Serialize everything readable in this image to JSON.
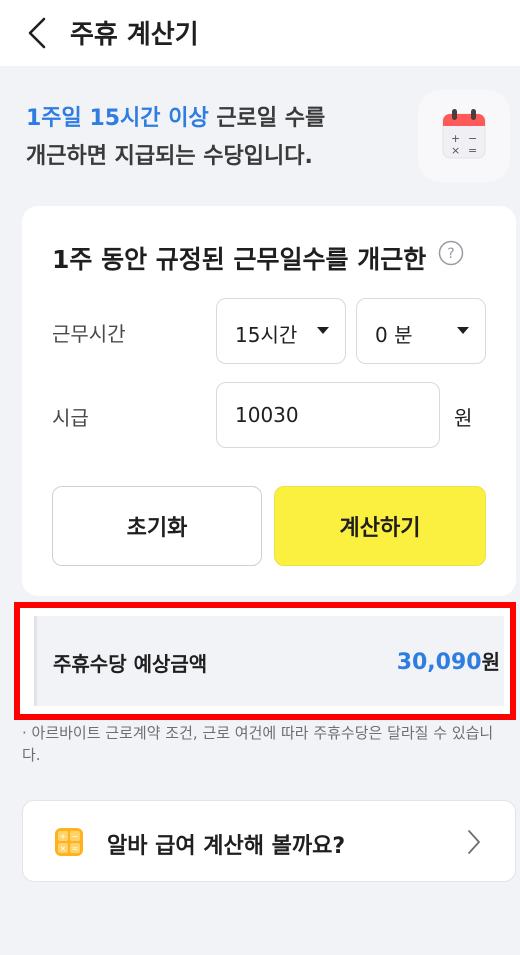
{
  "header": {
    "title": "주휴 계산기",
    "back_icon": "chevron-left-icon"
  },
  "intro": {
    "highlight": "1주일 15시간 이상",
    "line1_rest": " 근로일 수를",
    "line2": "개근하면 지급되는 수당입니다.",
    "icon": "calendar-calculator-icon"
  },
  "form": {
    "title": "1주 동안 규정된 근무일수를 개근한",
    "help_icon": "question-circle-icon",
    "hours_label": "근무시간",
    "hours_value": "15시간",
    "minutes_value": "0 분",
    "wage_label": "시급",
    "wage_value": "10030",
    "wage_unit": "원",
    "reset_label": "초기화",
    "calc_label": "계산하기"
  },
  "result": {
    "label": "주휴수당 예상금액",
    "amount": "30,090",
    "unit": "원"
  },
  "notice": "· 아르바이트 근로계약 조건, 근로 여건에 따라 주휴수당은 달라질 수 있습니다.",
  "link": {
    "label": "알바 급여 계산해 볼까요?",
    "icon": "calculator-icon",
    "chevron": "chevron-right-icon"
  },
  "colors": {
    "accent_blue": "#2f7de1",
    "button_yellow": "#fbf03f",
    "highlight_red": "#ff0000",
    "background": "#f2f3f7"
  }
}
